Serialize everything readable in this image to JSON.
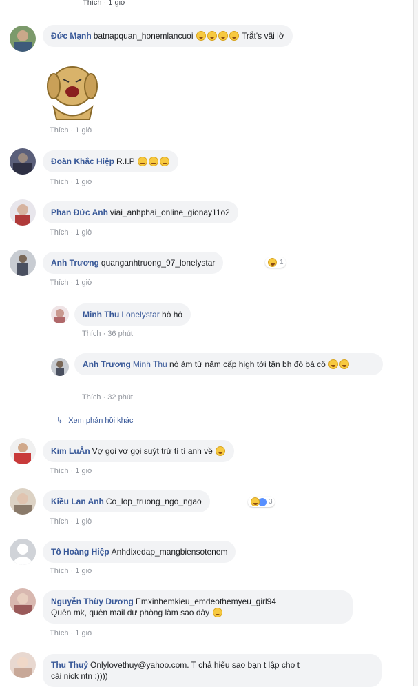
{
  "top": {
    "meta": "Thích · 1 giờ"
  },
  "comments": [
    {
      "name": "Đức Mạnh",
      "text": "batnapquan_honemlancuoi",
      "tail": "Trắt's vãi lờ",
      "meta": "Thích · 1 giờ"
    },
    {
      "name": "Đoàn Khắc Hiệp",
      "text": "R.I.P",
      "meta": "Thích · 1 giờ"
    },
    {
      "name": "Phan Đức Anh",
      "text": "viai_anhphai_online_gionay11o2",
      "meta": "Thích · 1 giờ"
    },
    {
      "name": "Anh Trương",
      "text": "quanganhtruong_97_lonelystar",
      "reaction_count": "1",
      "meta": "Thích · 1 giờ"
    },
    {
      "name": "Minh Thu",
      "tag": "Lonelystar",
      "text": "hô hô",
      "meta": "Thích · 36 phút"
    },
    {
      "name": "Anh Trương",
      "tag": "Minh Thu",
      "text": "nó ảm từ năm cấp high tới tận bh đó bà cô",
      "meta": "Thích · 32 phút"
    },
    {
      "name": "Kim LuÂn",
      "text": "Vợ gọi vợ gọi suýt trừ tí tí anh về",
      "meta": "Thích · 1 giờ"
    },
    {
      "name": "Kiều Lan Anh",
      "text": "Co_lop_truong_ngo_ngao",
      "reaction_count": "3",
      "meta": "Thích · 1 giờ"
    },
    {
      "name": "Tô Hoàng Hiệp",
      "text": "Anhdixedap_mangbiensotenem",
      "meta": "Thích · 1 giờ"
    },
    {
      "name": "Nguyễn Thùy Dương",
      "text": "Emxinhemkieu_emdeothemyeu_girl94",
      "line2": "Quên mk, quên mail dự phòng làm sao đây",
      "meta": "Thích · 1 giờ"
    },
    {
      "name": "Thu Thuỷ",
      "text": "Onlylovethuy@yahoo.com. T chả hiểu sao bạn t lập cho t",
      "line2": "cái nick ntn :))))"
    }
  ],
  "more_replies": "Xem phản hồi khác",
  "colors": {
    "name": "#385898",
    "bubble": "#f2f3f5",
    "meta": "#90949c"
  }
}
